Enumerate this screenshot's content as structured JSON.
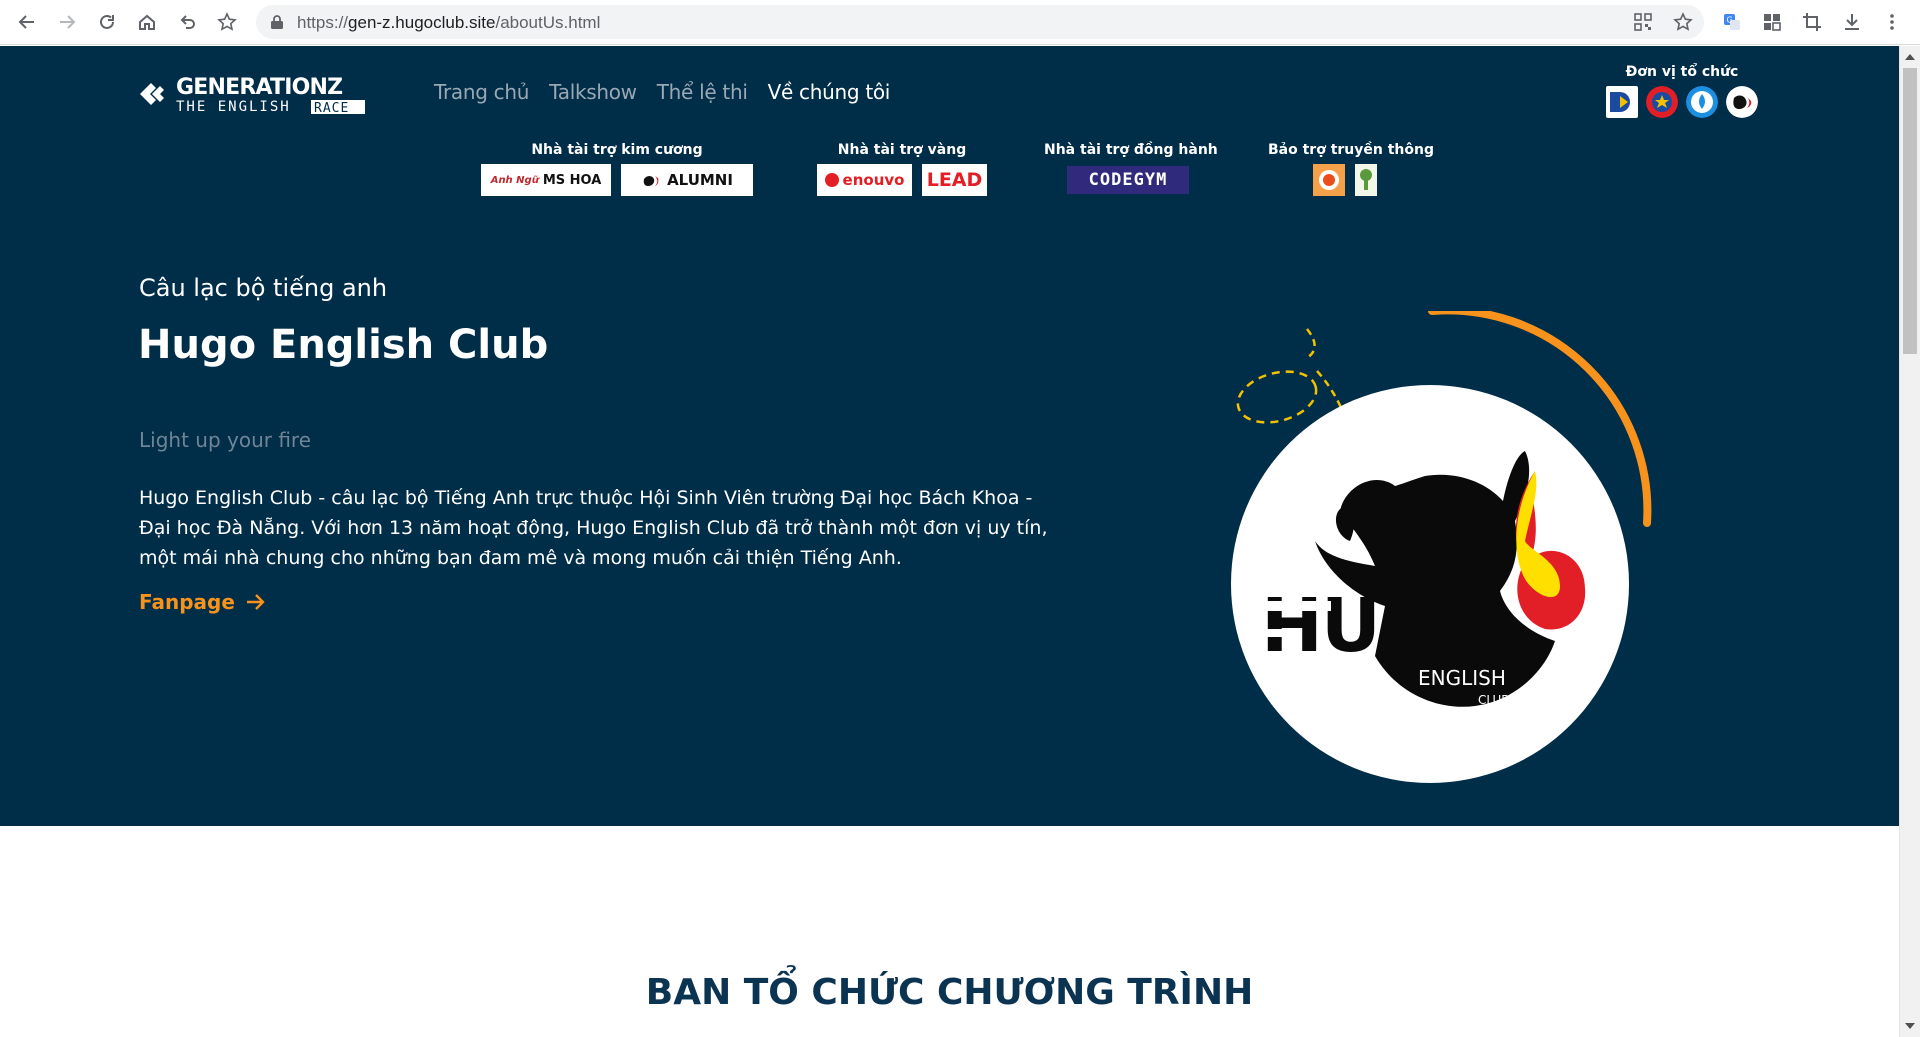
{
  "browser": {
    "url_prefix": "https://",
    "url_host": "gen-z.hugoclub.site",
    "url_path": "/aboutUs.html",
    "icons": [
      "back-icon",
      "forward-icon",
      "reload-icon",
      "home-icon",
      "undo-icon",
      "bookmark-star-icon",
      "qr-code-icon",
      "star-icon",
      "translate-icon",
      "extensions-icon",
      "crop-icon",
      "download-icon",
      "menu-icon"
    ]
  },
  "brand": {
    "logo_line1": "GENERATIONZ",
    "logo_line2a": "THE ENGLISH",
    "logo_line2b": "RACE"
  },
  "nav": {
    "items": [
      {
        "label": "Trang chủ"
      },
      {
        "label": "Talkshow"
      },
      {
        "label": "Thể lệ thi"
      },
      {
        "label": "Về chúng tôi"
      }
    ]
  },
  "organizers": {
    "title": "Đơn vị tổ chức"
  },
  "sponsors": {
    "diamond": {
      "title": "Nhà tài trợ kim cương",
      "logo1": "MS HOA",
      "logo1_pre": "Anh Ngữ",
      "logo2": "ALUMNI"
    },
    "gold": {
      "title": "Nhà tài trợ vàng",
      "logo1": "enouvo",
      "logo2": "LEAD"
    },
    "companion": {
      "title": "Nhà tài trợ đồng hành",
      "logo1": "CODEGYM"
    },
    "media": {
      "title": "Bảo trợ truyền thông"
    }
  },
  "hero": {
    "kicker": "Câu lạc bộ tiếng anh",
    "title": "Hugo English Club",
    "tagline": "Light up your fire",
    "description": "Hugo English Club - câu lạc bộ Tiếng Anh trực thuộc Hội Sinh Viên trường Đại học Bách Khoa - Đại học Đà Nẵng. Với hơn 13 năm hoạt động, Hugo English Club đã trở thành một đơn vị uy tín, một mái nhà chung cho những bạn đam mê và mong muốn cải thiện Tiếng Anh.",
    "cta": "Fanpage",
    "club_logo_word": "HUGO",
    "club_logo_sub1": "ENGLISH",
    "club_logo_sub2": "CLUB"
  },
  "section": {
    "title": "BAN TỔ CHỨC CHƯƠNG TRÌNH"
  },
  "colors": {
    "hero_bg": "#002d48",
    "accent": "#f7931d",
    "nav_inactive": "#9aa8b4",
    "section_title": "#0b3352"
  }
}
